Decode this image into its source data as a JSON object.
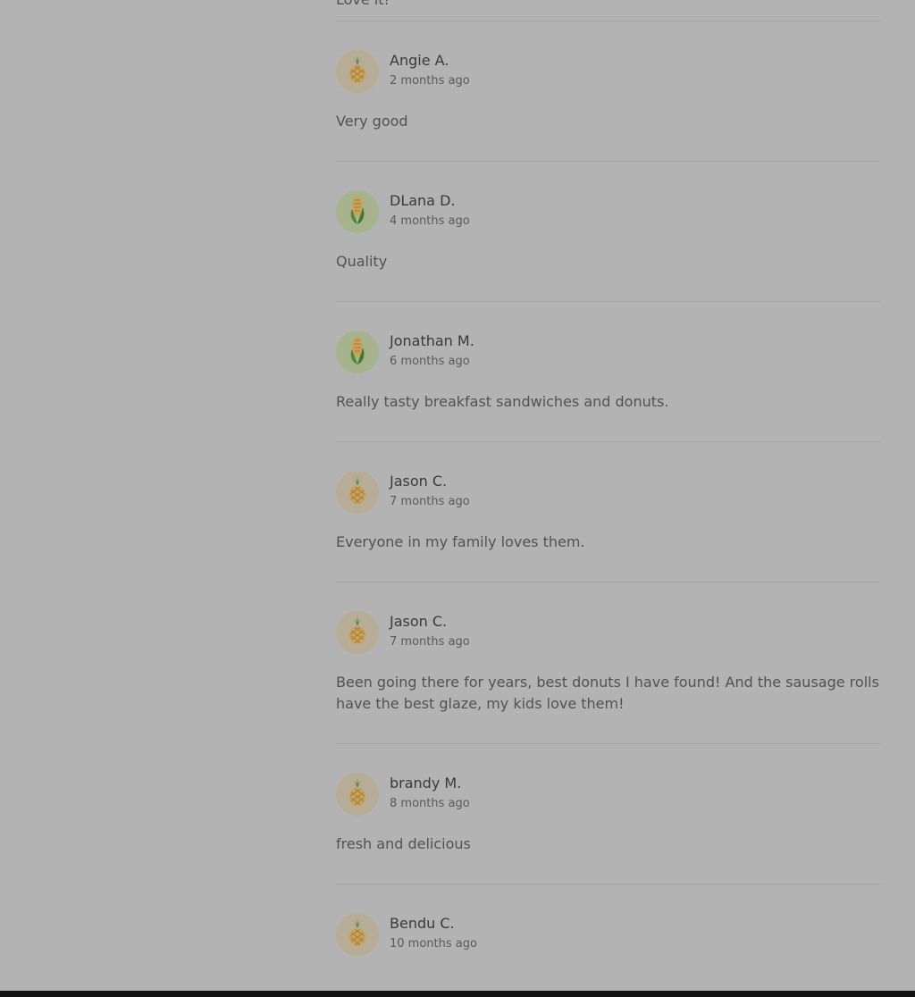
{
  "top_review_text": "Love it!",
  "reviews": [
    {
      "author": "Angie A.",
      "date": "2 months ago",
      "text": "Very good",
      "avatar": "pineapple-icon"
    },
    {
      "author": "DLana D.",
      "date": "4 months ago",
      "text": "Quality",
      "avatar": "corn-icon"
    },
    {
      "author": "Jonathan M.",
      "date": "6 months ago",
      "text": "Really tasty breakfast sandwiches and donuts.",
      "avatar": "corn-icon"
    },
    {
      "author": "Jason C.",
      "date": "7 months ago",
      "text": "Everyone in my family loves them.",
      "avatar": "pineapple-icon"
    },
    {
      "author": "Jason C.",
      "date": "7 months ago",
      "text": "Been going there for years, best donuts I have found! And the sausage rolls have the best glaze, my kids love them!",
      "avatar": "pineapple-icon"
    },
    {
      "author": "brandy M.",
      "date": "8 months ago",
      "text": "fresh and delicious",
      "avatar": "pineapple-icon"
    },
    {
      "author": "Bendu C.",
      "date": "10 months ago",
      "text": "",
      "avatar": "pineapple-icon"
    }
  ],
  "colors": {
    "overlay_background": "#b3b3b3",
    "pineapple_avatar_bg": "#b7ad96",
    "corn_avatar_bg": "#a7b38c",
    "bottom_bar": "#111111"
  }
}
